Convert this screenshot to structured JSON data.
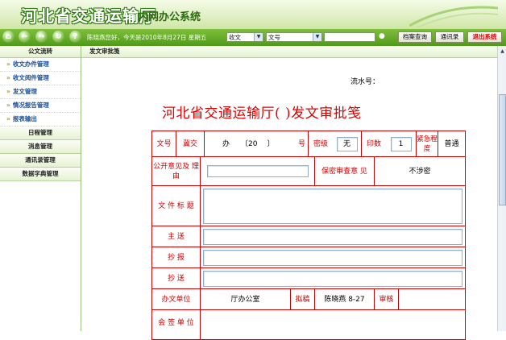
{
  "header": {
    "title": "河北省交通运输厅",
    "subtitle": "内网办公系统"
  },
  "toolbar": {
    "icons": [
      "home-icon",
      "back-icon",
      "forward-icon",
      "refresh-icon",
      "help-icon"
    ],
    "icon_glyphs": {
      "home": "⌂",
      "back": "←",
      "forward": "→",
      "refresh": "↻",
      "help": "?"
    },
    "greeting": "陈晓燕您好，今天是2010年8月27日 星期五",
    "select1_value": "收文",
    "select2_value": "文号",
    "search_value": "",
    "buttons": {
      "archive_query": "档案查询",
      "address_book": "通讯录",
      "exit": "退出系统"
    }
  },
  "sidebar": {
    "head": "公文流转",
    "items": [
      "收文办件管理",
      "收文阅件管理",
      "发文管理",
      "情况报告管理",
      "报表输出"
    ],
    "groups": [
      "日程管理",
      "消息管理",
      "通讯录管理",
      "数据字典管理"
    ]
  },
  "main": {
    "breadcrumb": "发文审批笺"
  },
  "doc": {
    "serial_label": "流水号：",
    "title": "河北省交通运输厅(            )发文审批笺",
    "row1": {
      "wenhao": "文号",
      "jijiao": "冀交",
      "ban": "办",
      "year_open": "〔20",
      "year_close": "〕",
      "hao": "号",
      "miji": "密级",
      "miji_value": "无",
      "yinshu": "印数",
      "yinshu_value": "1",
      "jinji": "紧急程度",
      "jinji_value": "普通"
    },
    "row2": {
      "gongkai": "公开意见及 理 由",
      "gongkai_value": "",
      "baomi": "保密审查意 见",
      "baomi_value": "不涉密"
    },
    "row3": {
      "label": "文 件 标 题",
      "value": ""
    },
    "row4": {
      "label": "主 送",
      "value": ""
    },
    "row5": {
      "label": "抄 报",
      "value": ""
    },
    "row6": {
      "label": "抄 送",
      "value": ""
    },
    "row7": {
      "unit_label": "办文单位",
      "unit_value": "厅办公室",
      "draft_label": "拟稿",
      "draft_value": "陈晓燕 8-27",
      "check_label": "审核",
      "check_value": ""
    },
    "row8": {
      "label": "会 签 单 位"
    }
  },
  "colors": {
    "red": "#cc0000",
    "green": "#4f9a1a",
    "link_blue": "#1a4f9a"
  }
}
